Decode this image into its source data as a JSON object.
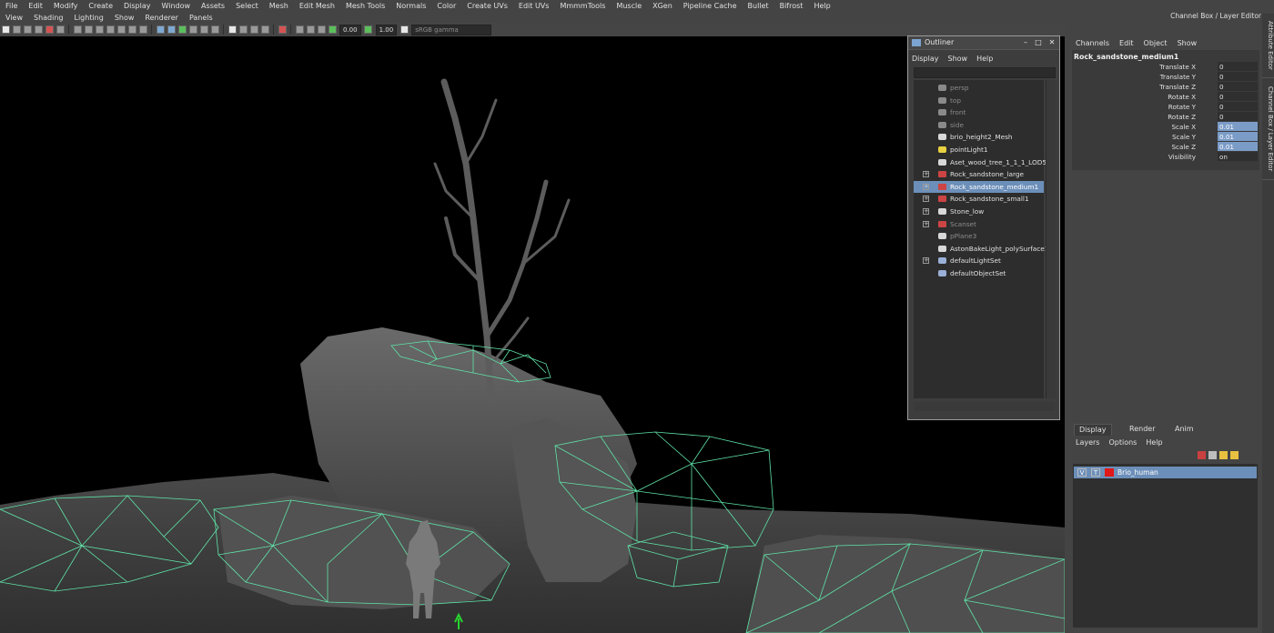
{
  "menubar": [
    "File",
    "Edit",
    "Modify",
    "Create",
    "Display",
    "Window",
    "Assets",
    "Select",
    "Mesh",
    "Edit Mesh",
    "Mesh Tools",
    "Normals",
    "Color",
    "Create UVs",
    "Edit UVs",
    "MmmmTools",
    "Muscle",
    "XGen",
    "Pipeline Cache",
    "Bullet",
    "Bifrost",
    "Help"
  ],
  "viewport_menu": [
    "View",
    "Shading",
    "Lighting",
    "Show",
    "Renderer",
    "Panels"
  ],
  "toolbar": {
    "field1": "0.00",
    "field2": "1.00",
    "colorspace": "sRGB gamma"
  },
  "outliner": {
    "title": "Outliner",
    "menu": [
      "Display",
      "Show",
      "Help"
    ],
    "items": [
      {
        "label": "persp",
        "dim": true,
        "icon": "camera-icon",
        "expand": false
      },
      {
        "label": "top",
        "dim": true,
        "icon": "camera-icon",
        "expand": false
      },
      {
        "label": "front",
        "dim": true,
        "icon": "camera-icon",
        "expand": false
      },
      {
        "label": "side",
        "dim": true,
        "icon": "camera-icon",
        "expand": false
      },
      {
        "label": "brio_height2_Mesh",
        "dim": false,
        "icon": "transform-icon",
        "expand": false
      },
      {
        "label": "pointLight1",
        "dim": false,
        "icon": "light-icon",
        "expand": false
      },
      {
        "label": "Aset_wood_tree_1_1_1_LOD5",
        "dim": false,
        "icon": "transform-icon",
        "expand": false
      },
      {
        "label": "Rock_sandstone_large",
        "dim": false,
        "icon": "mesh-icon",
        "expand": true
      },
      {
        "label": "Rock_sandstone_medium1",
        "dim": false,
        "icon": "mesh-icon",
        "expand": true,
        "selected": true
      },
      {
        "label": "Rock_sandstone_small1",
        "dim": false,
        "icon": "mesh-icon",
        "expand": true
      },
      {
        "label": "Stone_low",
        "dim": false,
        "icon": "transform-icon",
        "expand": true
      },
      {
        "label": "Scanset",
        "dim": true,
        "icon": "mesh-icon",
        "expand": true
      },
      {
        "label": "pPlane3",
        "dim": true,
        "icon": "transform-icon",
        "expand": false
      },
      {
        "label": "AstonBakeLight_polySurface1",
        "dim": false,
        "icon": "transform-icon",
        "expand": false
      },
      {
        "label": "defaultLightSet",
        "dim": false,
        "icon": "set-icon",
        "expand": true
      },
      {
        "label": "defaultObjectSet",
        "dim": false,
        "icon": "set-icon",
        "expand": false
      }
    ]
  },
  "channelbox": {
    "title": "Channel Box / Layer Editor",
    "menu": [
      "Channels",
      "Edit",
      "Object",
      "Show"
    ],
    "object": "Rock_sandstone_medium1",
    "attrs": [
      {
        "label": "Translate X",
        "value": "0",
        "hl": false
      },
      {
        "label": "Translate Y",
        "value": "0",
        "hl": false
      },
      {
        "label": "Translate Z",
        "value": "0",
        "hl": false
      },
      {
        "label": "Rotate X",
        "value": "0",
        "hl": false
      },
      {
        "label": "Rotate Y",
        "value": "0",
        "hl": false
      },
      {
        "label": "Rotate Z",
        "value": "0",
        "hl": false
      },
      {
        "label": "Scale X",
        "value": "0.01",
        "hl": true
      },
      {
        "label": "Scale Y",
        "value": "0.01",
        "hl": true
      },
      {
        "label": "Scale Z",
        "value": "0.01",
        "hl": true
      },
      {
        "label": "Visibility",
        "value": "on",
        "hl": false
      }
    ]
  },
  "side_tabs": [
    "Attribute Editor",
    "Channel Box / Layer Editor"
  ],
  "layers": {
    "tabs": [
      "Display",
      "Render",
      "Anim"
    ],
    "menu": [
      "Layers",
      "Options",
      "Help"
    ],
    "rows": [
      {
        "v": "V",
        "t": "T",
        "color": "#e01818",
        "name": "Brio_human"
      }
    ]
  },
  "colors": {
    "wire": "#5fe3a8",
    "selection": "#6c8fb9"
  }
}
